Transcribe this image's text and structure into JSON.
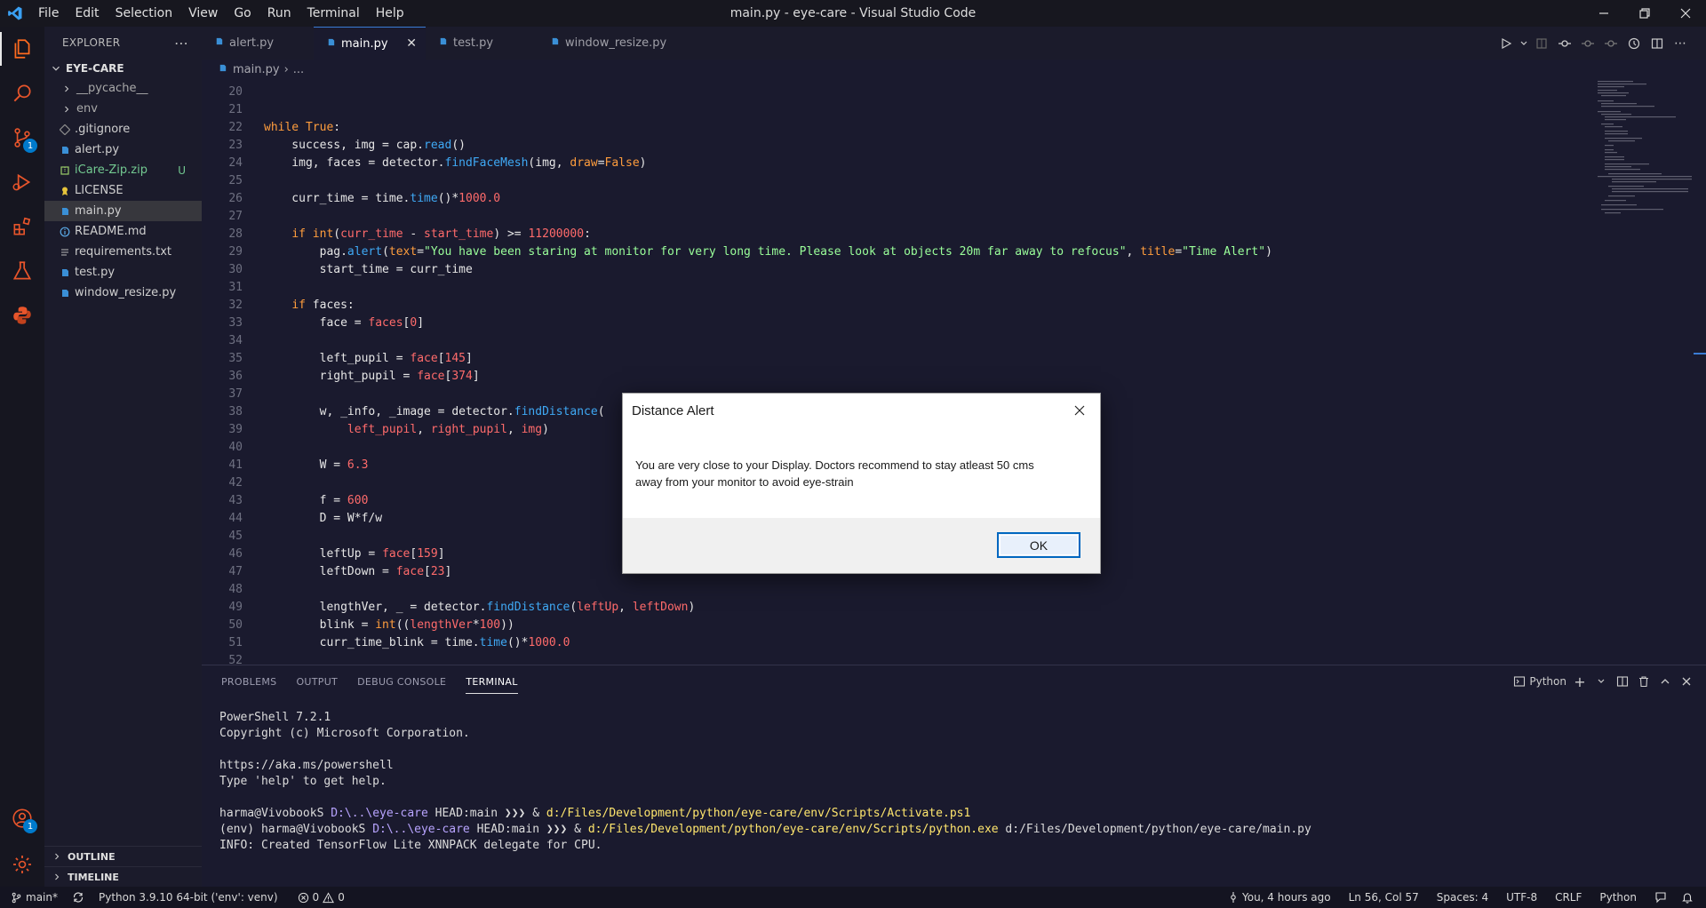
{
  "titlebar": {
    "menus": [
      "File",
      "Edit",
      "Selection",
      "View",
      "Go",
      "Run",
      "Terminal",
      "Help"
    ],
    "title": "main.py - eye-care - Visual Studio Code"
  },
  "activitybar": {
    "scm_badge": "1",
    "accounts_badge": "1"
  },
  "sidebar": {
    "header": "EXPLORER",
    "folder": "EYE-CARE",
    "items": [
      {
        "label": "__pycache__",
        "type": "folder"
      },
      {
        "label": "env",
        "type": "folder"
      },
      {
        "label": ".gitignore",
        "type": "git"
      },
      {
        "label": "alert.py",
        "type": "python"
      },
      {
        "label": "iCare-Zip.zip",
        "type": "zip",
        "git": "U"
      },
      {
        "label": "LICENSE",
        "type": "license"
      },
      {
        "label": "main.py",
        "type": "python",
        "selected": true
      },
      {
        "label": "README.md",
        "type": "info"
      },
      {
        "label": "requirements.txt",
        "type": "text"
      },
      {
        "label": "test.py",
        "type": "python"
      },
      {
        "label": "window_resize.py",
        "type": "python"
      }
    ],
    "outline": "OUTLINE",
    "timeline": "TIMELINE"
  },
  "tabs": [
    {
      "label": "alert.py",
      "active": false
    },
    {
      "label": "main.py",
      "active": true
    },
    {
      "label": "test.py",
      "active": false
    },
    {
      "label": "window_resize.py",
      "active": false
    }
  ],
  "breadcrumb": {
    "file": "main.py",
    "rest": "..."
  },
  "editor": {
    "line_numbers": [
      "20",
      "21",
      "22",
      "23",
      "24",
      "25",
      "26",
      "27",
      "28",
      "29",
      "30",
      "31",
      "32",
      "33",
      "34",
      "35",
      "36",
      "37",
      "38",
      "39",
      "40",
      "41",
      "42",
      "43",
      "44",
      "45",
      "46",
      "47",
      "48",
      "49",
      "50",
      "51",
      "52"
    ]
  },
  "panel": {
    "tabs": [
      "PROBLEMS",
      "OUTPUT",
      "DEBUG CONSOLE",
      "TERMINAL"
    ],
    "active_tab": "TERMINAL",
    "shell": "Python",
    "terminal": {
      "line1": "PowerShell 7.2.1",
      "line2": "Copyright (c) Microsoft Corporation.",
      "line3": "https://aka.ms/powershell",
      "line4": "Type 'help' to get help.",
      "p1_user": "harma@VivobookS ",
      "p1_path": "D:\\..\\eye-care",
      "p1_git": " HEAD:main ",
      "p1_arrow": "❯❯❯ & ",
      "p1_cmd": "d:/Files/Development/python/eye-care/env/Scripts/Activate.ps1",
      "p2_user": "(env) harma@VivobookS ",
      "p2_path": "D:\\..\\eye-care",
      "p2_git": " HEAD:main ",
      "p2_arrow": "❯❯❯ & ",
      "p2_cmd": "d:/Files/Development/python/eye-care/env/Scripts/python.exe",
      "p2_arg": " d:/Files/Development/python/eye-care/main.py",
      "line_info": "INFO: Created TensorFlow Lite XNNPACK delegate for CPU."
    }
  },
  "statusbar": {
    "branch": "main*",
    "interpreter": "Python 3.9.10 64-bit ('env': venv)",
    "errors": "0",
    "warnings": "0",
    "blame": "You, 4 hours ago",
    "position": "Ln 56, Col 57",
    "spaces": "Spaces: 4",
    "encoding": "UTF-8",
    "eol": "CRLF",
    "language": "Python"
  },
  "dialog": {
    "title": "Distance Alert",
    "message_line1": "You are very close to your Display. Doctors recommend to stay atleast 50 cms",
    "message_line2": "away from your monitor to avoid eye-strain",
    "ok": "OK"
  },
  "colors": {
    "accent": "#007acc",
    "keyword": "#ff9d3d",
    "function": "#3fa9f5",
    "number": "#ff6b6b",
    "string": "#9aff9a"
  }
}
